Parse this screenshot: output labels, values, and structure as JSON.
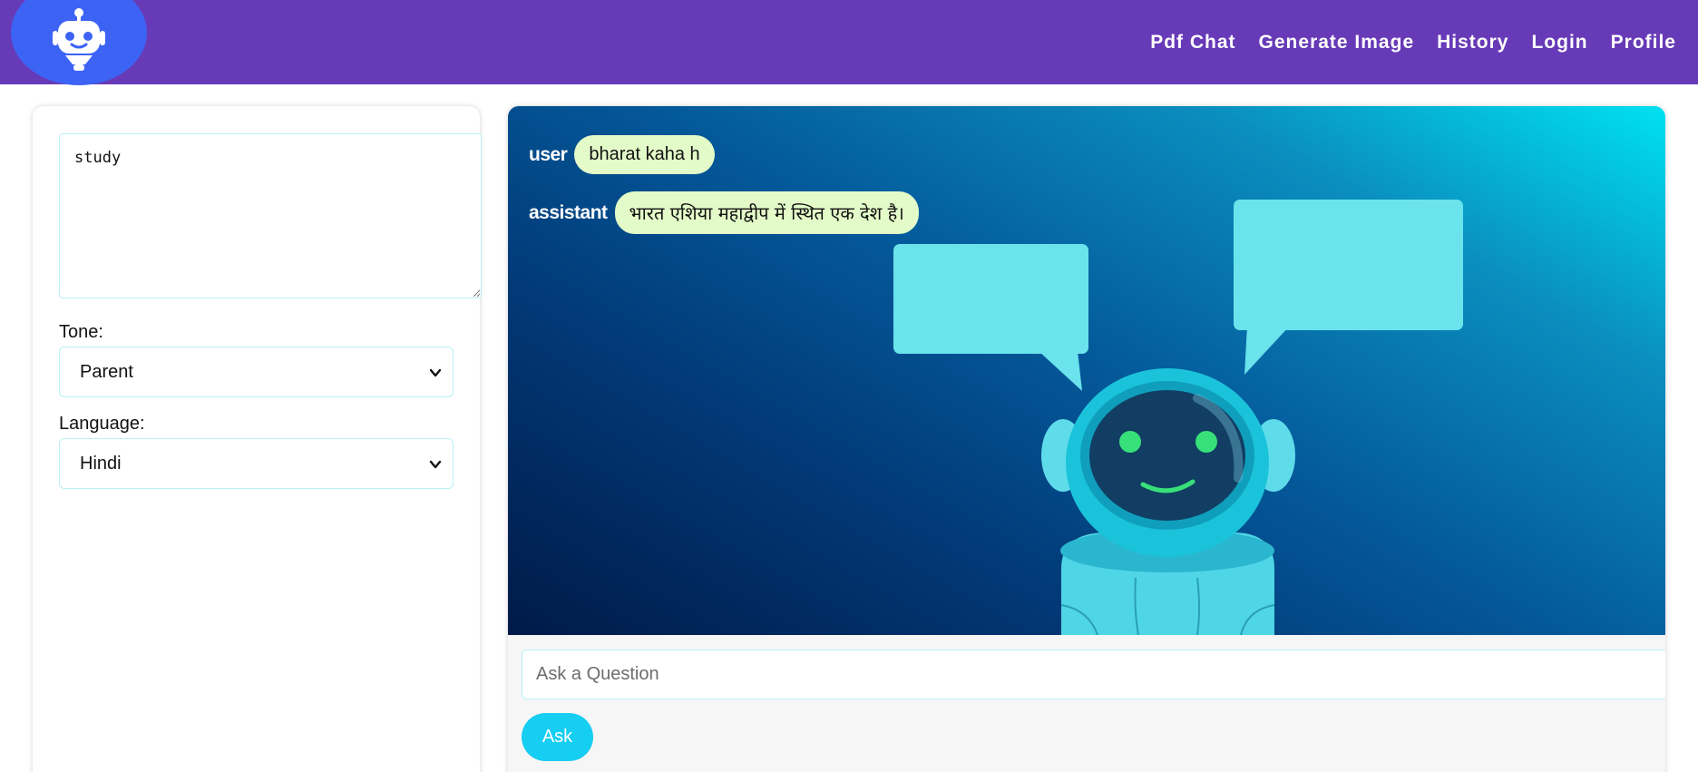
{
  "navbar": {
    "links": [
      "Pdf Chat",
      "Generate Image",
      "History",
      "Login",
      "Profile"
    ],
    "logo_icon": "robot-icon",
    "bg_color": "#673ab7",
    "logo_bg_color": "#3d63f5"
  },
  "settings": {
    "prompt_value": "study",
    "tone_label": "Tone:",
    "tone_value": "Parent",
    "language_label": "Language:",
    "language_value": "Hindi"
  },
  "chat": {
    "messages": [
      {
        "role": "user",
        "text": "bharat kaha h"
      },
      {
        "role": "assistant",
        "text": "भारत एशिया महाद्वीप में स्थित एक देश है।"
      }
    ],
    "bubble_color": "#e3fbc8",
    "input_placeholder": "Ask a Question",
    "ask_label": "Ask",
    "ask_color": "#16cdf2"
  }
}
